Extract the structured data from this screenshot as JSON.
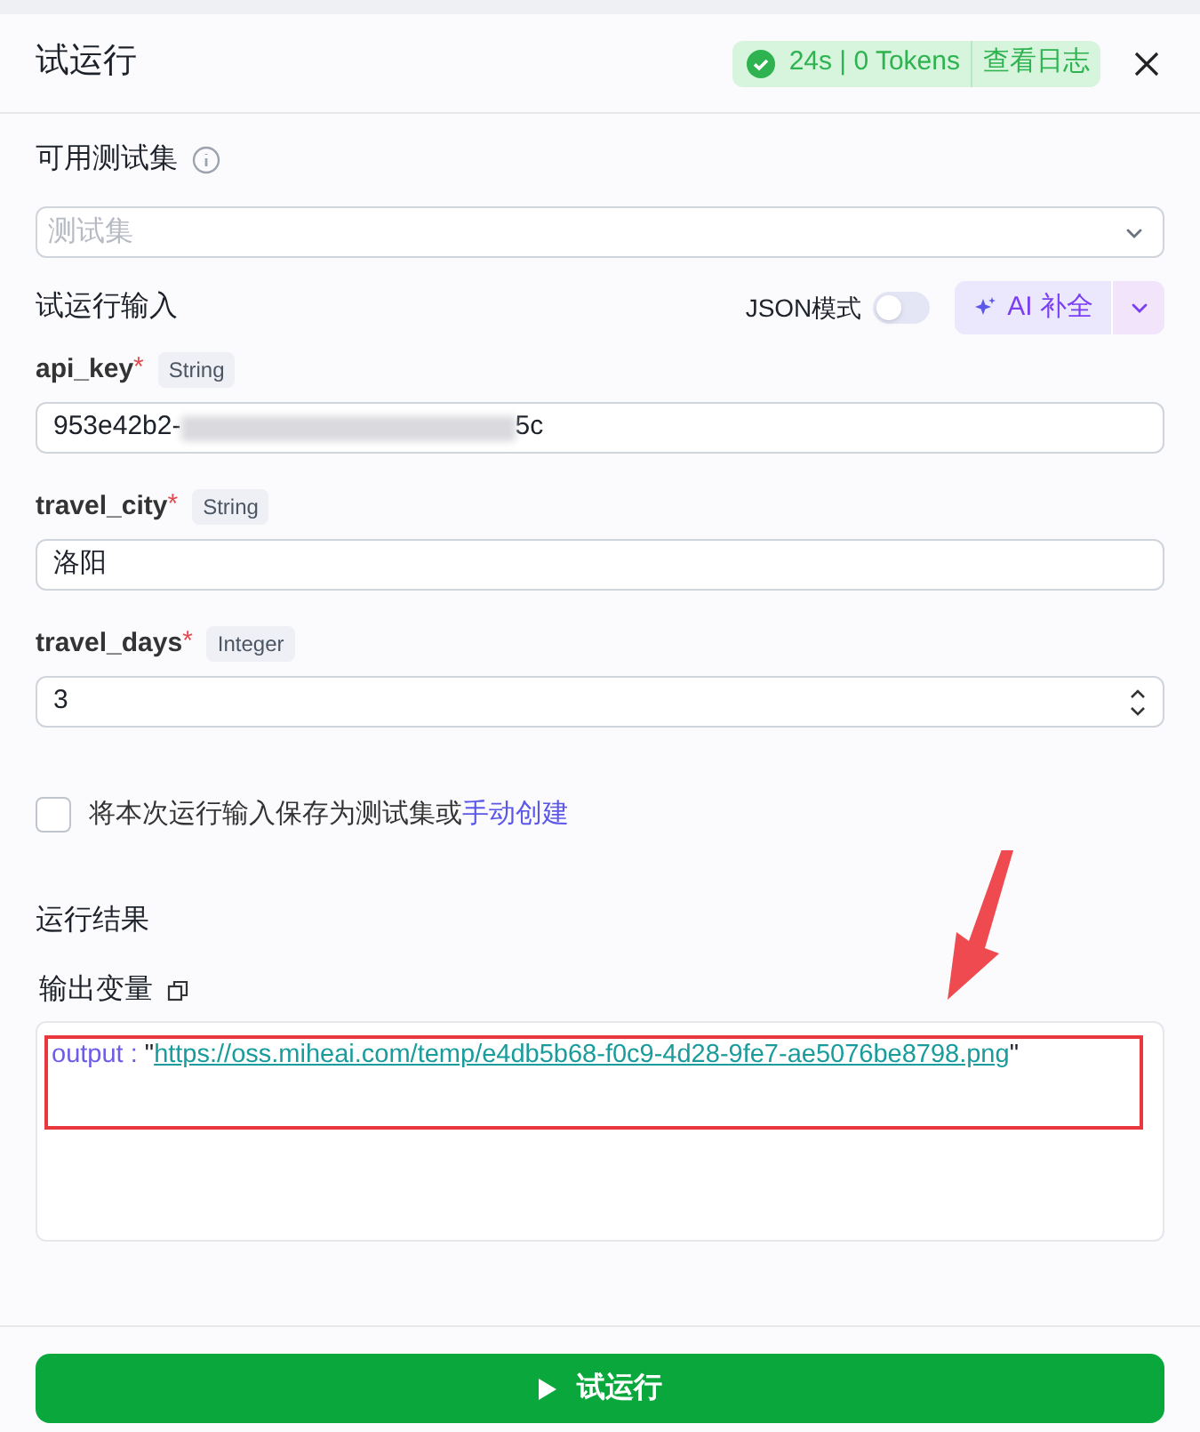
{
  "dialog": {
    "title": "试运行",
    "status": {
      "ok": true,
      "summary": "24s | 0 Tokens",
      "log_link": "查看日志"
    }
  },
  "test_set": {
    "label": "可用测试集",
    "placeholder": "测试集"
  },
  "inputs_header": {
    "label": "试运行输入",
    "json_mode_label": "JSON模式",
    "json_mode_on": false,
    "ai_button": "AI 补全"
  },
  "fields": [
    {
      "kind": "redacted",
      "name": "api_key",
      "required_mark": "*",
      "type": "String",
      "value_start": "953e42b2-",
      "value_end": "5c"
    },
    {
      "kind": "text",
      "name": "travel_city",
      "required_mark": "*",
      "type": "String",
      "value": "洛阳"
    },
    {
      "kind": "number",
      "name": "travel_days",
      "required_mark": "*",
      "type": "Integer",
      "value": "3"
    }
  ],
  "save_option": {
    "checked": false,
    "text": "将本次运行输入保存为测试集或",
    "link": "手动创建"
  },
  "result": {
    "label": "运行结果",
    "output_label": "输出变量",
    "outputs": [
      {
        "key": "output",
        "separator": " : ",
        "quote": "\"",
        "url": "https://oss.miheai.com/temp/e4db5b68-f0c9-4d28-9fe7-ae5076be8798.png"
      }
    ]
  },
  "annotations": {
    "highlight_box": true,
    "arrow": true
  },
  "run_button": "试运行"
}
